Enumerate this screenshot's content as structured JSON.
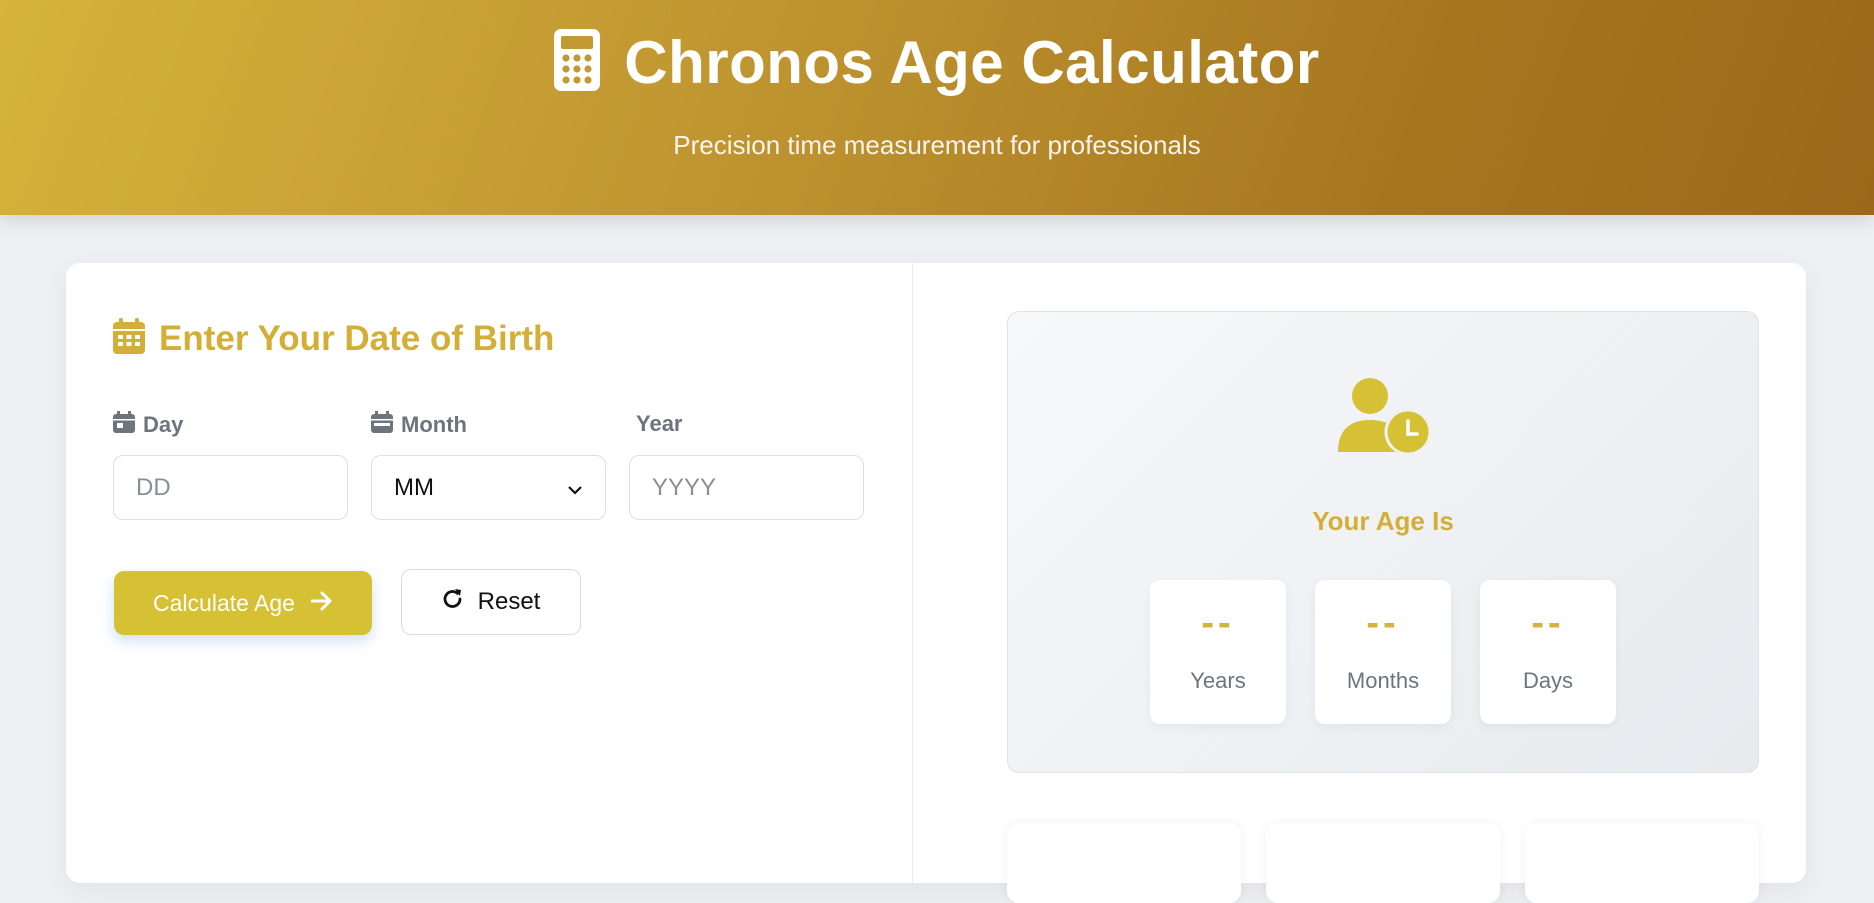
{
  "header": {
    "title": "Chronos Age Calculator",
    "subtitle": "Precision time measurement for professionals",
    "icon": "calculator-icon"
  },
  "form": {
    "section_title": "Enter Your Date of Birth",
    "day": {
      "label": "Day",
      "placeholder": "DD",
      "value": ""
    },
    "month": {
      "label": "Month",
      "selected": "MM"
    },
    "year": {
      "label": "Year",
      "placeholder": "YYYY",
      "value": ""
    },
    "calculate_label": "Calculate Age",
    "reset_label": "Reset"
  },
  "result": {
    "title": "Your Age Is",
    "years": {
      "value": "--",
      "label": "Years"
    },
    "months": {
      "value": "--",
      "label": "Months"
    },
    "days": {
      "value": "--",
      "label": "Days"
    }
  },
  "colors": {
    "accent": "#d4af37",
    "button": "#d6c033",
    "header_start": "#d6b33a",
    "header_end": "#9b6819"
  }
}
